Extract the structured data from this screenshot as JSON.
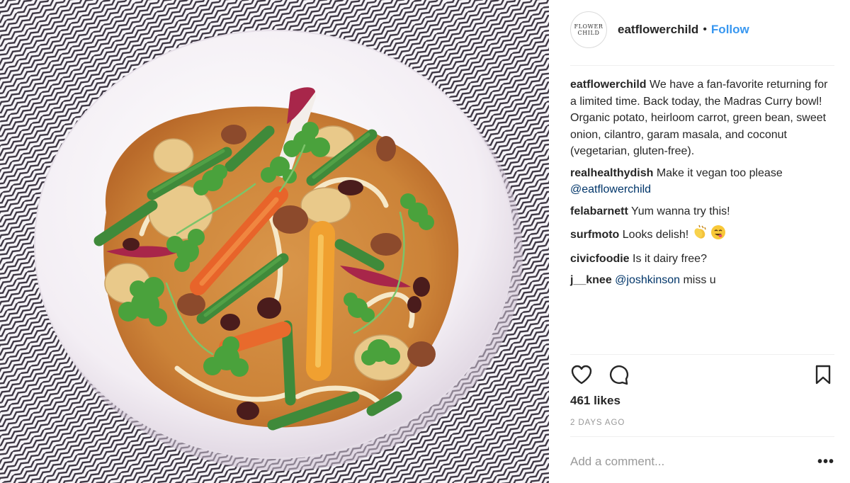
{
  "post": {
    "account": {
      "username": "eatflowerchild",
      "avatar_text_line1": "FLOWER",
      "avatar_text_line2": "CHILD",
      "separator": "•",
      "follow_label": "Follow"
    },
    "caption": {
      "username": "eatflowerchild",
      "text": "We have a fan-favorite returning for a limited time. Back today, the Madras Curry bowl! Organic potato, heirloom carrot, green bean, sweet onion, cilantro, garam masala, and coconut (vegetarian, gluten-free)."
    },
    "comments": [
      {
        "username": "realhealthydish",
        "text": "Make it vegan too please",
        "mention": "@eatflowerchild"
      },
      {
        "username": "felabarnett",
        "text": "Yum wanna try this!"
      },
      {
        "username": "surfmoto",
        "text": "Looks delish!"
      },
      {
        "username": "civicfoodie",
        "text": "Is it dairy free?"
      },
      {
        "username": "j__knee",
        "mention": "@joshkinson",
        "text": "miss u"
      }
    ],
    "likes": "461 likes",
    "timestamp": "2 DAYS AGO",
    "add_comment_placeholder": "Add a comment...",
    "more_label": "•••",
    "icons": {
      "like": "heart-outline-icon",
      "comment": "speech-bubble-icon",
      "save": "bookmark-icon",
      "clap": "clapping-hands-emoji",
      "yum": "yum-face-emoji"
    },
    "colors": {
      "link": "#3897f0",
      "mention": "#003569",
      "muted": "#999999",
      "divider": "#efefef"
    }
  }
}
